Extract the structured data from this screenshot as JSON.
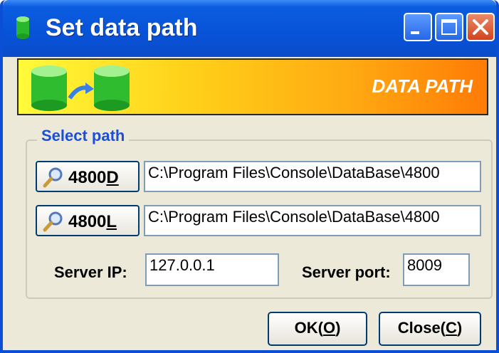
{
  "window": {
    "title": "Set data path"
  },
  "banner": {
    "text": "DATA PATH"
  },
  "select_path": {
    "legend": "Select path",
    "rows": [
      {
        "button_prefix": "4800",
        "button_mnemonic": "D",
        "path": "C:\\Program Files\\Console\\DataBase\\4800"
      },
      {
        "button_prefix": "4800",
        "button_mnemonic": "L",
        "path": "C:\\Program Files\\Console\\DataBase\\4800"
      }
    ],
    "server_ip_label": "Server IP:",
    "server_ip": "127.0.0.1",
    "server_port_label": "Server port:",
    "server_port": "8009"
  },
  "actions": {
    "ok_prefix": "OK(",
    "ok_mnemonic": "O",
    "ok_suffix": ")",
    "close_prefix": "Close(",
    "close_mnemonic": "C",
    "close_suffix": ")"
  },
  "colors": {
    "titlebar": "#0852d8",
    "legend": "#1c4fd6",
    "banner_start": "#fffa3a",
    "banner_end": "#ff7b06"
  },
  "icons": [
    "database-icon",
    "minimize-icon",
    "maximize-icon",
    "close-icon",
    "database-transfer-icon",
    "magnifier-icon"
  ]
}
